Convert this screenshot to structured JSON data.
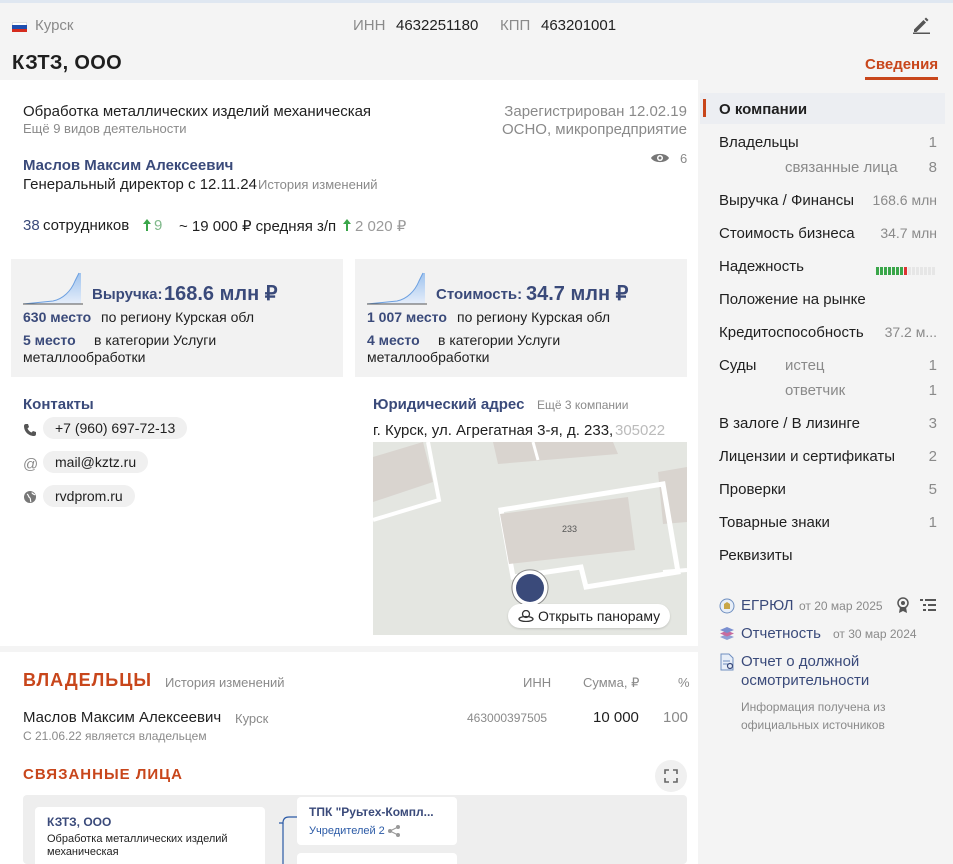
{
  "header": {
    "city": "Курск",
    "inn_label": "ИНН",
    "inn_value": "4632251180",
    "kpp_label": "КПП",
    "kpp_value": "463201001",
    "company_name": "КЗТЗ, ООО",
    "tab_active": "Сведения",
    "flag_colors": [
      "#ffffff",
      "#1f4fb0",
      "#d52b1e"
    ]
  },
  "activity": {
    "main": "Обработка металлических изделий механическая",
    "more": "Ещё 9 видов деятельности",
    "registered": "Зарегистрирован 12.02.19",
    "tax": "ОСНО, микропредприятие"
  },
  "director": {
    "name": "Маслов Максим Алексеевич",
    "position": "Генеральный директор с 12.11.24",
    "history": "История изменений",
    "views": "6"
  },
  "staff": {
    "count": "38",
    "label": "сотрудников",
    "delta": "9",
    "salary": "~ 19 000 ₽ средняя з/п",
    "salary_delta": "2 020 ₽"
  },
  "revenue_card": {
    "label": "Выручка:",
    "value": "168.6 млн ₽",
    "rank_region": "630 место",
    "rank_region_text": "по региону Курская обл",
    "rank_cat": "5 место",
    "rank_cat_text": "в категории Услуги металлообработки"
  },
  "value_card": {
    "label": "Стоимость:",
    "value": "34.7 млн ₽",
    "rank_region": "1 007 место",
    "rank_region_text": "по региону Курская обл",
    "rank_cat": "4 место",
    "rank_cat_text": "в категории Услуги металлообработки"
  },
  "contacts": {
    "title": "Контакты",
    "phone": "+7 (960) 697-72-13",
    "email": "mail@kztz.ru",
    "site": "rvdprom.ru"
  },
  "address": {
    "title": "Юридический адрес",
    "more": "Ещё 3 компании",
    "text": "г. Курск, ул. Агрегатная 3-я, д. 233,",
    "zip": "305022",
    "map_label": "233",
    "panorama": "Открыть панораму"
  },
  "owners": {
    "title": "ВЛАДЕЛЬЦЫ",
    "history": "История изменений",
    "col_inn": "ИНН",
    "col_sum": "Сумма, ₽",
    "col_pct": "%",
    "rows": [
      {
        "name": "Маслов Максим Алексеевич",
        "city": "Курск",
        "since": "С 21.06.22 является владельцем",
        "inn": "463000397505",
        "sum": "10 000",
        "pct": "100"
      }
    ]
  },
  "related": {
    "title": "СВЯЗАННЫЕ ЛИЦА",
    "node1_title": "КЗТЗ, ООО",
    "node1_sub": "Обработка металлических изделий механическая",
    "node2_title": "ТПК \"Руьтех-Компл...",
    "node2_sub": "Учредителей 2"
  },
  "sidebar": {
    "items": [
      {
        "label": "О компании",
        "num": ""
      },
      {
        "label": "Владельцы",
        "num": "1"
      },
      {
        "label": "связанные лица",
        "num": "8"
      },
      {
        "label": "Выручка / Финансы",
        "num": "168.6 млн"
      },
      {
        "label": "Стоимость бизнеса",
        "num": "34.7 млн"
      },
      {
        "label": "Надежность",
        "num": ""
      },
      {
        "label": "Положение на рынке",
        "num": ""
      },
      {
        "label": "Кредитоспособность",
        "num": "37.2 м..."
      },
      {
        "label": "Суды",
        "num": ""
      },
      {
        "label": "истец",
        "num": "1"
      },
      {
        "label": "ответчик",
        "num": "1"
      },
      {
        "label": "В залоге / В лизинге",
        "num": "3"
      },
      {
        "label": "Лицензии и сертификаты",
        "num": "2"
      },
      {
        "label": "Проверки",
        "num": "5"
      },
      {
        "label": "Товарные знаки",
        "num": "1"
      },
      {
        "label": "Реквизиты",
        "num": ""
      }
    ],
    "reliability_level": 0.55,
    "egrul_label": "ЕГРЮЛ",
    "egrul_date": "от 20 мар 2025",
    "report_label": "Отчетность",
    "report_date": "от 30 мар 2024",
    "diligence_label": "Отчет о должной осмотрительности",
    "source_note": "Информация получена из официальных источников"
  },
  "colors": {
    "accent": "#c8461b",
    "navy": "#3a4a7a",
    "green": "#3aa64a"
  }
}
